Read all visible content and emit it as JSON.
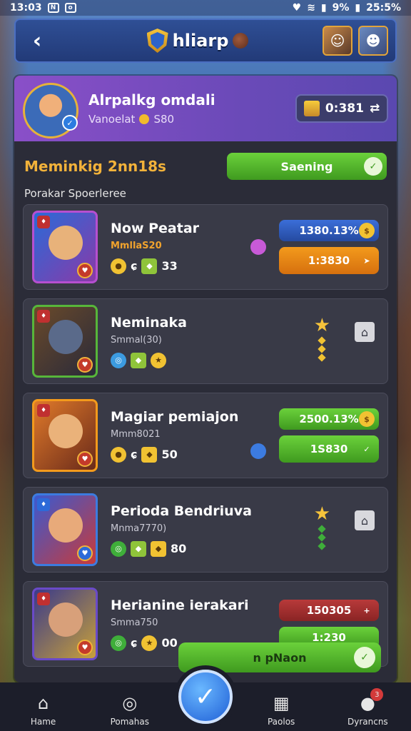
{
  "status": {
    "time": "13:03",
    "battery": "9%",
    "clock": "25:5%"
  },
  "header": {
    "title": "hliarp",
    "back_icon": "back-arrow-icon"
  },
  "profile": {
    "name": "Alrpalkg omdali",
    "sub_label": "Vanoelat",
    "sub_value": "S80",
    "currency_value": "0:381"
  },
  "section": {
    "title": "Meminkig 2nn18s",
    "subtitle": "Porakar Spoerleree",
    "action_label": "Saening"
  },
  "rows": [
    {
      "name": "Now Peatar",
      "sub": "MmllaS20",
      "stat_value": "33",
      "top_pill": "1380.13%",
      "bottom_pill": "1:3830"
    },
    {
      "name": "Neminaka",
      "sub": "Smmal(30)"
    },
    {
      "name": "Magiar pemiajon",
      "sub": "Mmm8021",
      "stat_value": "50",
      "top_pill": "2500.13%",
      "bottom_pill": "1S830"
    },
    {
      "name": "Perioda Bendriuva",
      "sub": "Mnma7770)",
      "stat_value": "80"
    },
    {
      "name": "Herianine ierakari",
      "sub": "Smma750",
      "stat_value": "00",
      "top_pill": "150305",
      "bottom_pill": "1:230"
    }
  ],
  "floating": {
    "label": "n pNaon"
  },
  "nav": [
    {
      "label": "Hame"
    },
    {
      "label": "Pomahas"
    },
    {
      "label": "Paolos"
    },
    {
      "label": "Dyrancns",
      "badge": "3"
    }
  ]
}
